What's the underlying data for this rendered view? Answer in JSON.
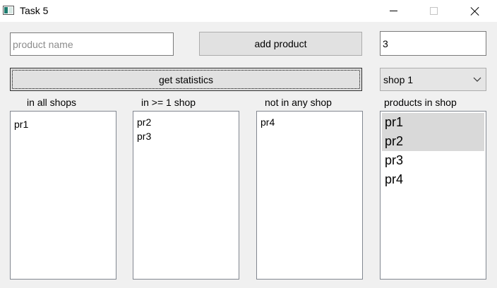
{
  "window": {
    "title": "Task 5",
    "icons": {
      "app": "app-window-icon",
      "minimize": "minimize-icon",
      "maximize": "maximize-icon",
      "close": "close-icon"
    }
  },
  "form": {
    "product_name_placeholder": "product name",
    "product_name_value": "",
    "add_button_label": "add product",
    "quantity_value": "3",
    "stats_button_label": "get statistics",
    "shop_selected": "shop 1",
    "shop_options": [
      "shop 1"
    ]
  },
  "labels": {
    "in_all_shops": "in all shops",
    "in_one_shop": "in >= 1 shop",
    "not_in_any_shop": "not in any shop",
    "products_in_shop": "products in shop"
  },
  "lists": {
    "in_all_shops": [
      "pr1"
    ],
    "in_one_shop": [
      "pr2",
      "pr3"
    ],
    "not_in_any_shop": [
      "pr4"
    ],
    "products_in_shop": [
      {
        "label": "pr1",
        "selected": true
      },
      {
        "label": "pr2",
        "selected": true
      },
      {
        "label": "pr3",
        "selected": false
      },
      {
        "label": "pr4",
        "selected": false
      }
    ]
  }
}
